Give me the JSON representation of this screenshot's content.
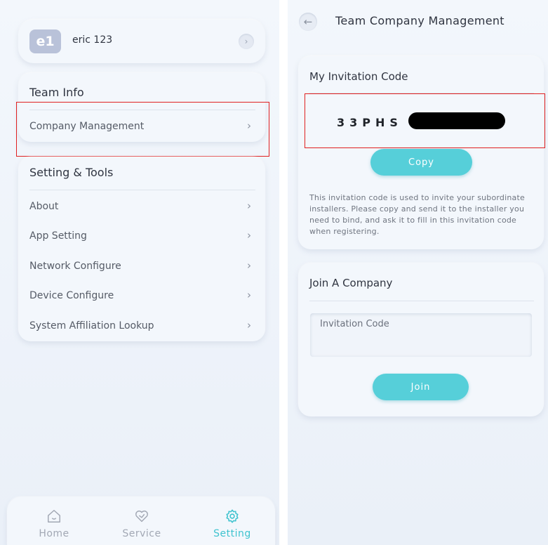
{
  "left": {
    "profile": {
      "avatar_text": "e1",
      "username": "eric 123",
      "arrow": "›"
    },
    "team_info": {
      "title": "Team Info",
      "items": [
        {
          "label": "Company Management"
        }
      ]
    },
    "settings": {
      "title": "Setting & Tools",
      "items": [
        {
          "label": "About"
        },
        {
          "label": "App Setting"
        },
        {
          "label": "Network Configure"
        },
        {
          "label": "Device Configure"
        },
        {
          "label": "System Affiliation Lookup"
        }
      ]
    },
    "chevron": "›",
    "nav": {
      "items": [
        {
          "label": "Home",
          "icon": "home-icon"
        },
        {
          "label": "Service",
          "icon": "service-icon"
        },
        {
          "label": "Setting",
          "icon": "gear-icon",
          "active": true
        }
      ]
    }
  },
  "right": {
    "header": {
      "title": "Team Company Management",
      "back": "←"
    },
    "invitation": {
      "title": "My Invitation Code",
      "code_visible": "33PHS",
      "copy_label": "Copy",
      "description": "This invitation code is used to invite your subordinate installers. Please copy and send it to the installer you need to bind, and ask it to fill in this invitation code when registering."
    },
    "join": {
      "title": "Join A Company",
      "placeholder": "Invitation Code",
      "join_label": "Join"
    }
  },
  "colors": {
    "accent": "#56cfd9",
    "active_nav": "#3fc3cf",
    "highlight": "#e02020"
  }
}
